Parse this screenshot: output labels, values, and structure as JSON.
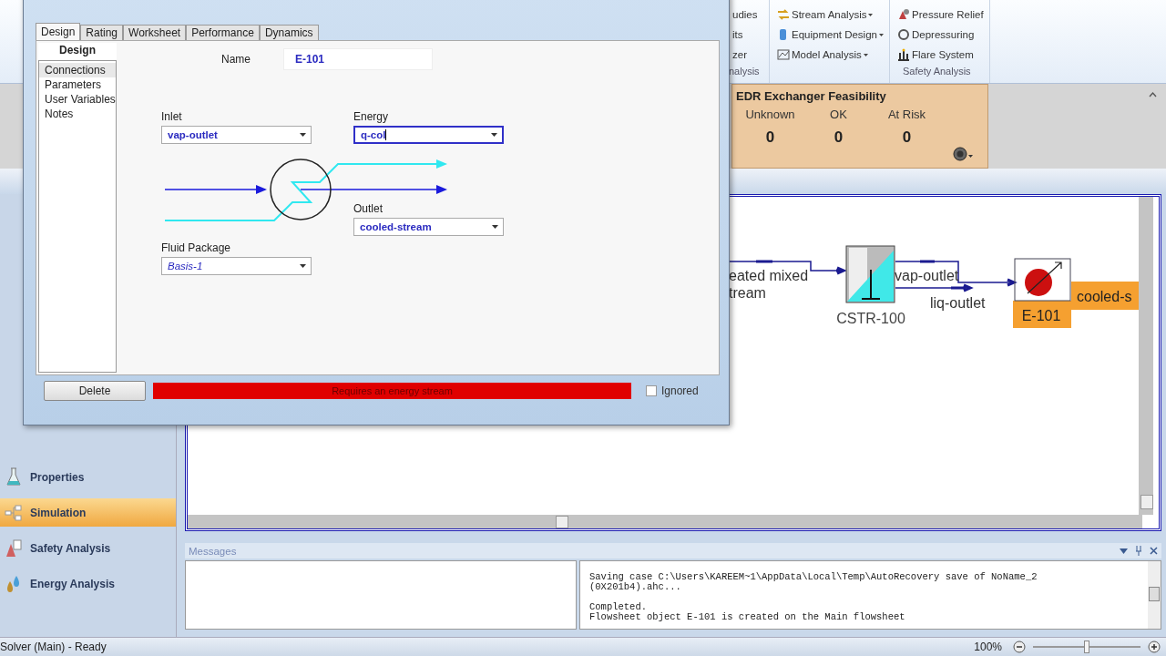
{
  "dialog": {
    "tabs": [
      {
        "label": "Design",
        "selected": true
      },
      {
        "label": "Rating",
        "selected": false
      },
      {
        "label": "Worksheet",
        "selected": false
      },
      {
        "label": "Performance",
        "selected": false
      },
      {
        "label": "Dynamics",
        "selected": false
      }
    ],
    "side_title": "Design",
    "side_items": [
      {
        "label": "Connections",
        "selected": true
      },
      {
        "label": "Parameters",
        "selected": false
      },
      {
        "label": "User Variables",
        "selected": false
      },
      {
        "label": "Notes",
        "selected": false
      }
    ],
    "name": {
      "label": "Name",
      "value": "E-101"
    },
    "inlet": {
      "label": "Inlet",
      "value": "vap-outlet",
      "focused": false
    },
    "energy": {
      "label": "Energy",
      "value": "q-col",
      "focused": true
    },
    "outlet": {
      "label": "Outlet",
      "value": "cooled-stream",
      "focused": false
    },
    "fluid_package": {
      "label": "Fluid Package",
      "value": "Basis-1",
      "focused": false
    },
    "delete_button": "Delete",
    "status_message": "Requires an energy stream",
    "ignored": {
      "label": "Ignored",
      "checked": false
    }
  },
  "ribbon": {
    "groups": [
      {
        "label": "nalysis",
        "items": [
          {
            "label": "udies",
            "dropdown": false
          },
          {
            "label": "its",
            "dropdown": false
          },
          {
            "label": "zer",
            "dropdown": false
          }
        ]
      },
      {
        "items": [
          {
            "label": "Stream Analysis",
            "dropdown": true
          },
          {
            "label": "Equipment Design",
            "dropdown": true
          },
          {
            "label": "Model Analysis",
            "dropdown": true
          }
        ]
      },
      {
        "label": "Safety Analysis",
        "items": [
          {
            "label": "Pressure Relief",
            "dropdown": false
          },
          {
            "label": "Depressuring",
            "dropdown": false
          },
          {
            "label": "Flare System",
            "dropdown": false
          }
        ]
      }
    ]
  },
  "edr_panel": {
    "title": "EDR Exchanger Feasibility",
    "counts": [
      {
        "label": "Unknown",
        "value": "0"
      },
      {
        "label": "OK",
        "value": "0"
      },
      {
        "label": "At Risk",
        "value": "0"
      }
    ]
  },
  "navigation": [
    {
      "label": "Properties",
      "selected": false
    },
    {
      "label": "Simulation",
      "selected": true
    },
    {
      "label": "Safety Analysis",
      "selected": false
    },
    {
      "label": "Energy Analysis",
      "selected": false
    }
  ],
  "flowsheet": {
    "streams": [
      {
        "lines": [
          "eated mixed",
          "tream"
        ],
        "selected": false
      },
      {
        "lines": [
          "vap-outlet"
        ],
        "selected": false
      },
      {
        "lines": [
          "liq-outlet"
        ],
        "selected": false
      },
      {
        "lines": [
          "cooled-s"
        ],
        "selected": true
      }
    ],
    "units": [
      {
        "name": "CSTR-100",
        "selected": false
      },
      {
        "name": "E-101",
        "selected": true
      }
    ]
  },
  "messages": {
    "title": "Messages",
    "blocks": [
      [
        "Saving case C:\\Users\\KAREEM~1\\AppData\\Local\\Temp\\AutoRecovery save of NoName_2",
        "(0X201b4).ahc..."
      ],
      [
        "Completed.",
        "Flowsheet object E-101 is created on the Main flowsheet"
      ]
    ]
  },
  "status_bar": {
    "text": "Solver (Main) - Ready",
    "zoom": "100%",
    "zoom_slider": {
      "level": 0.5
    }
  }
}
